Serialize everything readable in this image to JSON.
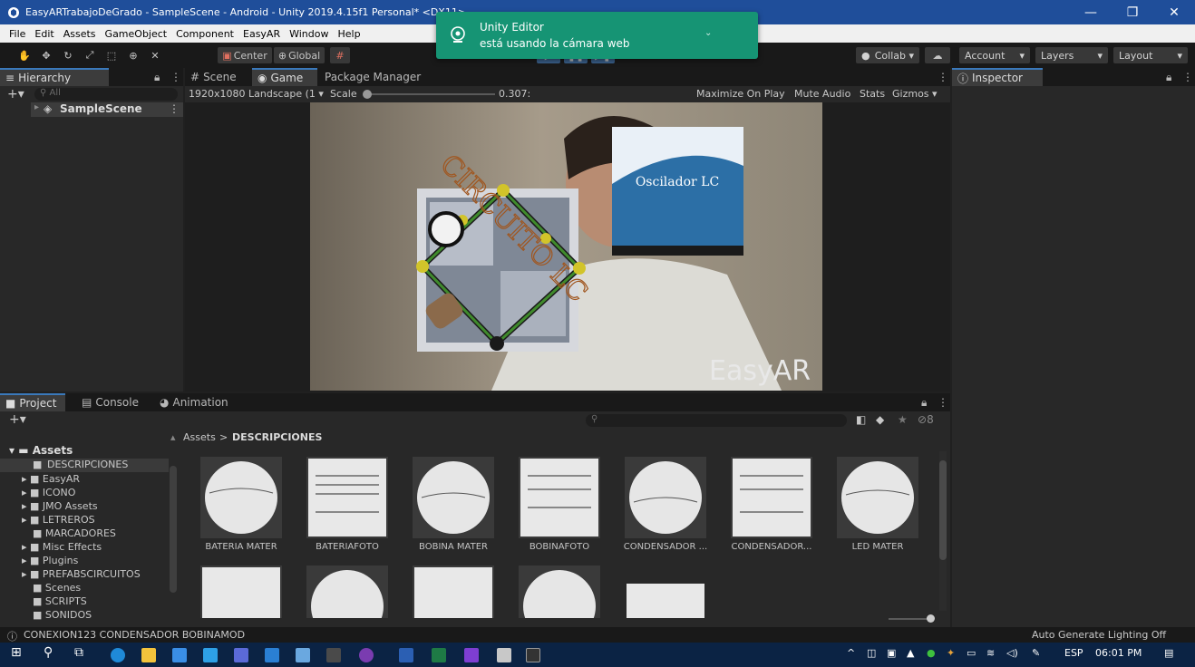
{
  "window": {
    "title": "EasyARTrabajoDeGrado - SampleScene - Android - Unity 2019.4.15f1 Personal* <DX11>",
    "minimize": "—",
    "maximize": "❐",
    "close": "✕"
  },
  "menu": [
    "File",
    "Edit",
    "Assets",
    "GameObject",
    "Component",
    "EasyAR",
    "Window",
    "Help"
  ],
  "toolbar": {
    "center_label": "Center",
    "global_label": "Global",
    "collab_label": "Collab ▾",
    "account_label": "Account",
    "layers_label": "Layers",
    "layout_label": "Layout"
  },
  "toast": {
    "app": "Unity Editor",
    "message": "está usando la cámara web"
  },
  "hierarchy": {
    "tab": "Hierarchy",
    "search_placeholder": "All",
    "scene_name": "SampleScene"
  },
  "scene_tabs": {
    "scene": "Scene",
    "game": "Game",
    "package_manager": "Package Manager"
  },
  "game_toolbar": {
    "resolution": "1920x1080 Landscape (1",
    "scale_label": "Scale",
    "scale_value": "0.307:",
    "maximize_on_play": "Maximize On Play",
    "mute_audio": "Mute Audio",
    "stats": "Stats",
    "gizmos": "Gizmos"
  },
  "game_view": {
    "circuit_text": "CIRCUITO LC",
    "slide_title": "Oscilador LC",
    "watermark": "EasyAR"
  },
  "inspector": {
    "tab": "Inspector"
  },
  "project": {
    "tabs": [
      "Project",
      "Console",
      "Animation"
    ],
    "breadcrumb_root": "Assets",
    "breadcrumb_sep": ">",
    "breadcrumb_current": "DESCRIPCIONES",
    "hidden_count": "8",
    "tree_root": "Assets",
    "tree": [
      "DESCRIPCIONES",
      "EasyAR",
      "ICONO",
      "JMO Assets",
      "LETREROS",
      "MARCADORES",
      "Misc Effects",
      "Plugins",
      "PREFABSCIRCUITOS",
      "Scenes",
      "SCRIPTS",
      "SONIDOS"
    ],
    "assets_row1": [
      "BATERIA MATER",
      "BATERIAFOTO",
      "BOBINA MATER",
      "BOBINAFOTO",
      "CONDENSADOR ...",
      "CONDENSADOR...",
      "LED MATER"
    ]
  },
  "status": {
    "message": "CONEXION123 CONDENSADOR BOBINAMOD",
    "right": "Auto Generate Lighting Off"
  },
  "taskbar": {
    "lang": "ESP",
    "time": "06:01 PM"
  },
  "colors": {
    "titlebar": "#1f4e9a",
    "toast": "#169474",
    "selection": "#2c5d87",
    "tab_accent": "#3a79bb"
  }
}
